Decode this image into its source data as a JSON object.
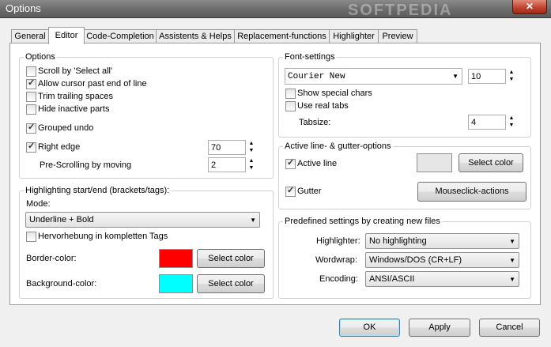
{
  "window": {
    "title": "Options",
    "watermark": "SOFTPEDIA",
    "close_label": "✕"
  },
  "tabs": [
    {
      "label": "General"
    },
    {
      "label": "Editor"
    },
    {
      "label": "Code-Completion"
    },
    {
      "label": "Assistents & Helps"
    },
    {
      "label": "Replacement-functions"
    },
    {
      "label": "Highlighter"
    },
    {
      "label": "Preview"
    }
  ],
  "options": {
    "title": "Options",
    "scroll_select_all": "Scroll by 'Select all'",
    "allow_cursor": "Allow cursor past end of line",
    "trim_trailing": "Trim trailing spaces",
    "hide_inactive": "Hide inactive parts",
    "grouped_undo": "Grouped undo",
    "right_edge": "Right edge",
    "right_edge_value": "70",
    "pre_scrolling": "Pre-Scrolling by moving",
    "pre_scrolling_value": "2"
  },
  "highlighting": {
    "title": "Highlighting start/end (brackets/tags):",
    "mode_label": "Mode:",
    "mode_value": "Underline + Bold",
    "hervorhebung": "Hervorhebung in kompletten Tags",
    "border_color_label": "Border-color:",
    "border_color": "#ff0000",
    "background_color_label": "Background-color:",
    "background_color": "#00ffff",
    "select_color": "Select color"
  },
  "font": {
    "title": "Font-settings",
    "font_name": "Courier New",
    "font_size": "10",
    "show_special": "Show special chars",
    "use_real_tabs": "Use real tabs",
    "tabsize_label": "Tabsize:",
    "tabsize_value": "4"
  },
  "activeline": {
    "title": "Active line- & gutter-options",
    "active_line": "Active line",
    "active_line_color": "#e6e6e6",
    "select_color": "Select color",
    "gutter": "Gutter",
    "mouseclick": "Mouseclick-actions"
  },
  "predefined": {
    "title": "Predefined settings by creating new files",
    "highlighter_label": "Highlighter:",
    "highlighter_value": "No highlighting",
    "wordwrap_label": "Wordwrap:",
    "wordwrap_value": "Windows/DOS (CR+LF)",
    "encoding_label": "Encoding:",
    "encoding_value": "ANSI/ASCII"
  },
  "footer": {
    "ok": "OK",
    "apply": "Apply",
    "cancel": "Cancel"
  },
  "icons": {
    "up": "▲",
    "down": "▼",
    "dropdown": "▼"
  }
}
